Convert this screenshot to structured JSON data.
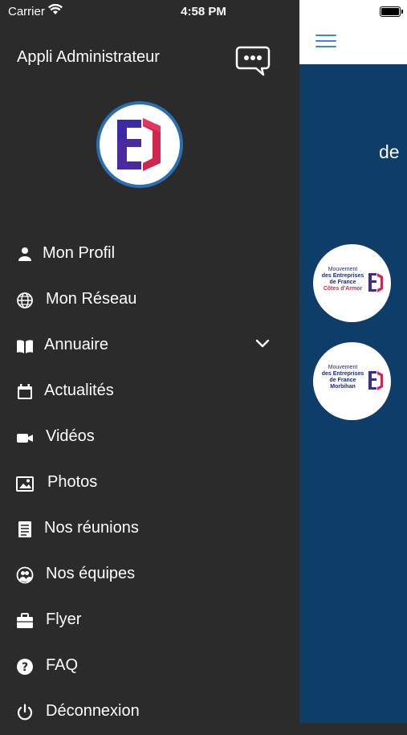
{
  "status_bar": {
    "carrier": "Carrier",
    "time": "4:58 PM"
  },
  "drawer": {
    "title": "Appli Administrateur",
    "menu": [
      {
        "label": "Mon Profil",
        "icon": "person-icon"
      },
      {
        "label": "Mon Réseau",
        "icon": "globe-icon"
      },
      {
        "label": "Annuaire",
        "icon": "book-icon",
        "expandable": true
      },
      {
        "label": "Actualités",
        "icon": "calendar-icon"
      },
      {
        "label": "Vidéos",
        "icon": "video-camera-icon"
      },
      {
        "label": "Photos",
        "icon": "photos-icon"
      },
      {
        "label": "Nos réunions",
        "icon": "document-list-icon"
      },
      {
        "label": "Nos équipes",
        "icon": "team-icon"
      },
      {
        "label": "Flyer",
        "icon": "briefcase-icon"
      },
      {
        "label": "FAQ",
        "icon": "question-icon"
      },
      {
        "label": "Déconnexion",
        "icon": "power-icon"
      }
    ]
  },
  "main": {
    "partial_heading": "de",
    "cards": [
      {
        "line1": "Mouvement",
        "line2": "des Entreprises",
        "line3": "de France",
        "region": "Côtes d'Armor"
      },
      {
        "line1": "Mouvement",
        "line2": "des Entreprises",
        "line3": "de France",
        "region": "Morbihan"
      }
    ]
  },
  "colors": {
    "drawer_bg": "#2b2b2b",
    "main_bg": "#0f3d6a",
    "accent": "#3a86d6",
    "brand_red": "#d0254c",
    "brand_blue": "#2a2a8a"
  }
}
